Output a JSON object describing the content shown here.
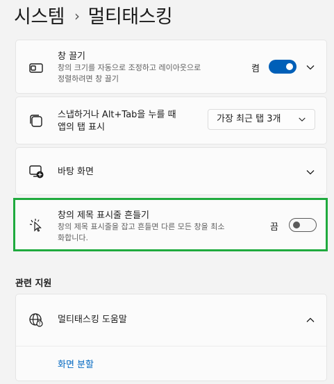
{
  "breadcrumb": {
    "parent": "시스템",
    "current": "멀티태스킹"
  },
  "snap_windows": {
    "title": "창 끌기",
    "desc_line1": "창의 크기를 자동으로 조정하고 레이아웃으로",
    "desc_line2": "정렬하려면 창 끌기",
    "state": "켬",
    "enabled": true
  },
  "alt_tab": {
    "title_line1": "스냅하거나 Alt+Tab을 누를 때",
    "title_line2": "앱의 탭 표시",
    "dropdown_value": "가장 최근 탭 3개"
  },
  "desktops": {
    "title": "바탕 화면"
  },
  "title_bar_shake": {
    "title": "창의 제목 표시줄 흔들기",
    "desc_line1": "창의 제목 표시줄을 잡고 흔들면 다른 모든 창을 최소",
    "desc_line2": "화합니다.",
    "state": "끔",
    "enabled": false
  },
  "related": {
    "heading": "관련 지원",
    "help_title": "멀티태스킹 도움말",
    "link": "화면 분할"
  },
  "colors": {
    "accent": "#005fb8",
    "highlight": "#1faa3e",
    "link": "#0067c0"
  }
}
